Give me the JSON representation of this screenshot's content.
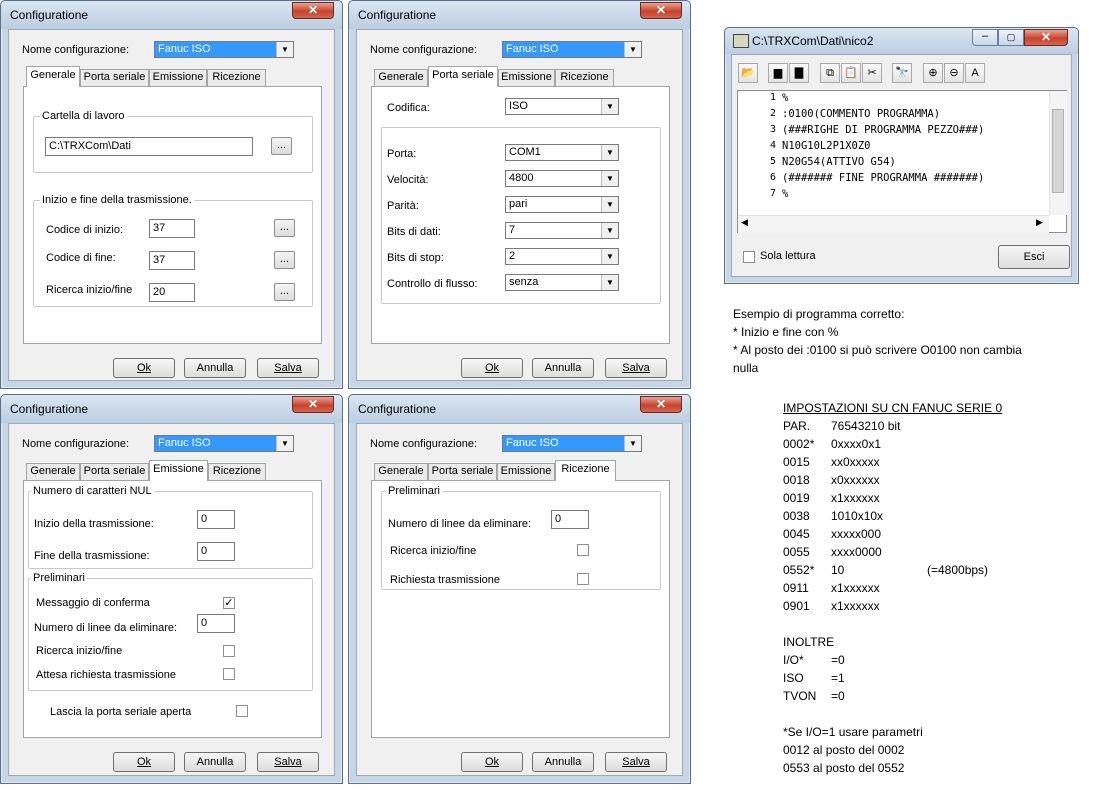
{
  "window_title": "Configuratione",
  "close_glyph": "✕",
  "config_label": "Nome configurazione:",
  "config_value": "Fanuc ISO",
  "tabs": [
    "Generale",
    "Porta seriale",
    "Emissione",
    "Ricezione"
  ],
  "buttons": {
    "ok": "Ok",
    "annulla": "Annulla",
    "salva": "Salva"
  },
  "ellipsis": "...",
  "generale": {
    "group_work": "Cartella di lavoro",
    "work_path": "C:\\TRXCom\\Dati",
    "group_trans": "Inizio e fine della trasmissione.",
    "start_code_label": "Codice di inizio:",
    "start_code": "37",
    "end_code_label": "Codice di fine:",
    "end_code": "37",
    "search_label": "Ricerca inizio/fine",
    "search_value": "20"
  },
  "seriale": {
    "codifica_label": "Codifica:",
    "codifica": "ISO",
    "porta_label": "Porta:",
    "porta": "COM1",
    "velocita_label": "Velocità:",
    "velocita": "4800",
    "parita_label": "Parità:",
    "parita": "pari",
    "bits_dati_label": "Bits di dati:",
    "bits_dati": "7",
    "bits_stop_label": "Bits di stop:",
    "bits_stop": "2",
    "flusso_label": "Controllo di flusso:",
    "flusso": "senza"
  },
  "emissione": {
    "group_nul": "Numero di caratteri NUL",
    "inizio_label": "Inizio della trasmissione:",
    "inizio_value": "0",
    "fine_label": "Fine della trasmissione:",
    "fine_value": "0",
    "group_prelim": "Preliminari",
    "conferma_label": "Messaggio di conferma",
    "conferma_check": "✓",
    "linee_label": "Numero di linee da eliminare:",
    "linee_value": "0",
    "ricerca_label": "Ricerca inizio/fine",
    "attesa_label": "Attesa richiesta trasmissione",
    "lascia_label": "Lascia la porta seriale aperta"
  },
  "ricezione": {
    "group_prelim": "Preliminari",
    "linee_label": "Numero di linee da eliminare:",
    "linee_value": "0",
    "ricerca_label": "Ricerca inizio/fine",
    "richiesta_label": "Richiesta trasmissione"
  },
  "editor": {
    "title": "C:\\TRXCom\\Dati\\nico2",
    "lines": [
      "%",
      ":0100(COMMENTO PROGRAMMA)",
      "(###RIGHE DI PROGRAMMA PEZZO###)",
      "N10G10L2P1X0Z0",
      "N20G54(ATTIVO G54)",
      "(####### FINE PROGRAMMA #######)",
      "%"
    ],
    "line_numbers": [
      "1",
      "2",
      "3",
      "4",
      "5",
      "6",
      "7"
    ],
    "readonly_label": "Sola lettura",
    "exit_label": "Esci"
  },
  "notes": {
    "example_lines": [
      "Esempio di programma corretto:",
      "* Inizio e fine con %",
      "* Al posto dei :0100 si può scrivere O0100 non cambia",
      "nulla"
    ],
    "heading": "IMPOSTAZIONI SU CN FANUC SERIE 0",
    "param_rows": [
      {
        "par": "PAR.",
        "val": "76543210 bit",
        "extra": ""
      },
      {
        "par": "0002*",
        "val": "0xxxx0x1",
        "extra": ""
      },
      {
        "par": "0015",
        "val": "xx0xxxxx",
        "extra": ""
      },
      {
        "par": "0018",
        "val": "x0xxxxxx",
        "extra": ""
      },
      {
        "par": "0019",
        "val": "x1xxxxxx",
        "extra": ""
      },
      {
        "par": "0038",
        "val": "1010x10x",
        "extra": ""
      },
      {
        "par": "0045",
        "val": "xxxxx000",
        "extra": ""
      },
      {
        "par": "0055",
        "val": "xxxx0000",
        "extra": ""
      },
      {
        "par": "0552*",
        "val": "10",
        "extra": "(=4800bps)"
      },
      {
        "par": "0911",
        "val": "x1xxxxxx",
        "extra": ""
      },
      {
        "par": "0901",
        "val": "x1xxxxxx",
        "extra": ""
      }
    ],
    "inoltre": "INOLTRE",
    "extra_rows": [
      {
        "key": "I/O*",
        "val": "=0"
      },
      {
        "key": "ISO",
        "val": "=1"
      },
      {
        "key": "TVON",
        "val": "=0"
      }
    ],
    "footer_lines": [
      "*Se I/O=1 usare parametri",
      "0012 al posto del 0002",
      "0553 al posto del 0552"
    ]
  }
}
